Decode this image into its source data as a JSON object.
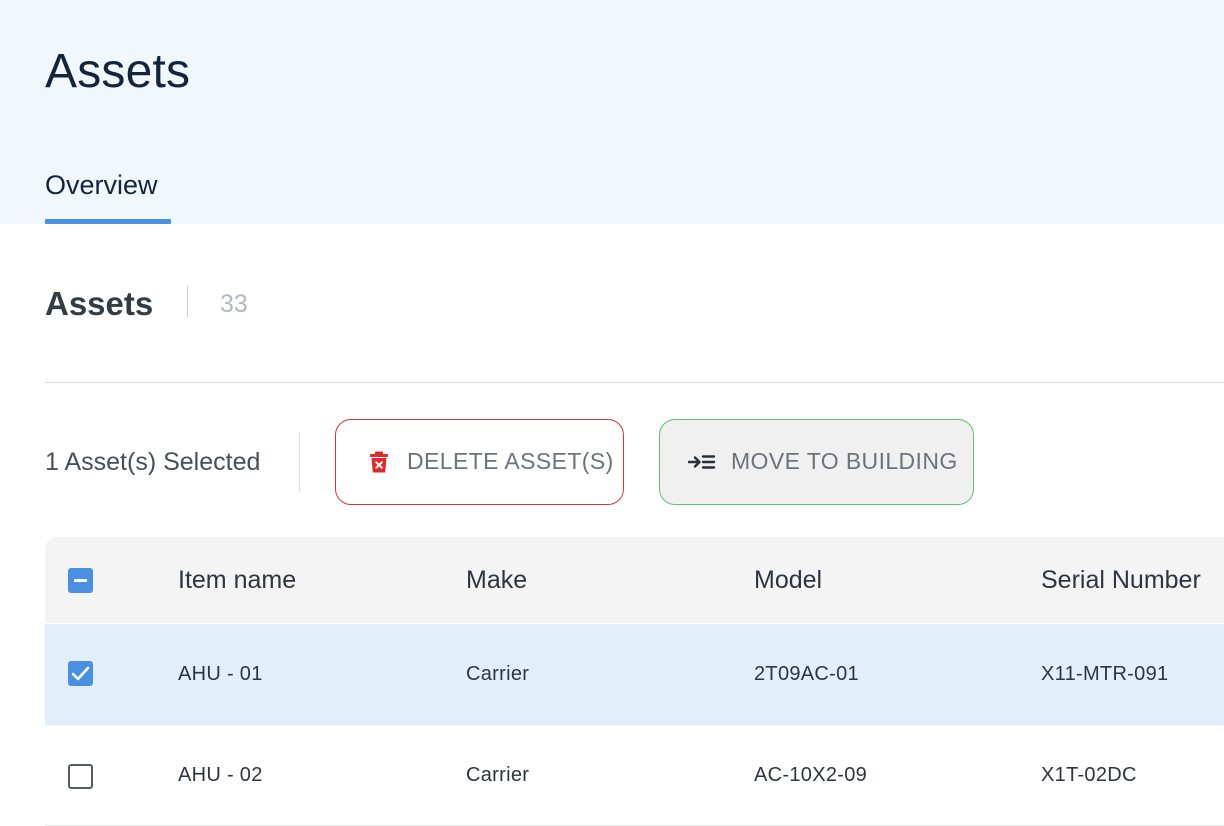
{
  "page": {
    "title": "Assets"
  },
  "tabs": [
    {
      "label": "Overview",
      "active": true
    }
  ],
  "section": {
    "title": "Assets",
    "count": "33"
  },
  "selection": {
    "text": "1 Asset(s) Selected"
  },
  "actions": {
    "delete_label": "DELETE ASSET(S)",
    "delete_icon": "trash-icon",
    "move_label": "MOVE TO BUILDING",
    "move_icon": "move-to-list-icon"
  },
  "table": {
    "columns": [
      "Item name",
      "Make",
      "Model",
      "Serial Number"
    ],
    "header_checkbox": "indeterminate",
    "rows": [
      {
        "checked": true,
        "item_name": "AHU - 01",
        "make": "Carrier",
        "model": "2T09AC-01",
        "serial": "X11-MTR-091"
      },
      {
        "checked": false,
        "item_name": "AHU - 02",
        "make": "Carrier",
        "model": "AC-10X2-09",
        "serial": "X1T-02DC"
      }
    ]
  },
  "colors": {
    "accent": "#4a90e2",
    "header_bg": "#f0f8fd",
    "delete_border": "#d93636",
    "move_border": "#5cc46e",
    "selected_row_bg": "#e3eefb"
  }
}
